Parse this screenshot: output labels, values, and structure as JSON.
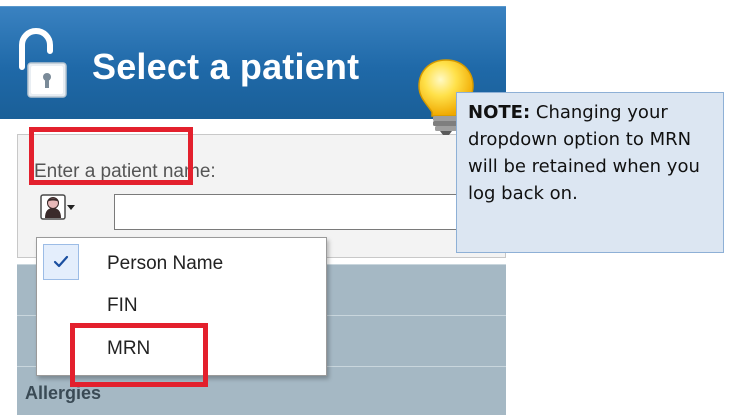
{
  "panel": {
    "title": "Select a patient",
    "search_label": "Enter a patient name:",
    "search_value": "",
    "header_color": "#2371b0"
  },
  "dropdown": {
    "selected": "Person Name",
    "options": [
      {
        "label": "Person Name",
        "checked": true
      },
      {
        "label": "FIN",
        "checked": false
      },
      {
        "label": "MRN",
        "checked": false
      }
    ]
  },
  "sections": [
    {
      "label": ""
    },
    {
      "label": ""
    },
    {
      "label": "Allergies"
    }
  ],
  "note": {
    "prefix": "NOTE:",
    "text": "Changing your dropdown option to MRN will be retained when you log back on."
  },
  "icons": {
    "lock": "lock-icon",
    "person": "person-icon",
    "dropdown_arrow": "chevron-down-icon",
    "check": "check-icon",
    "bulb": "lightbulb-icon"
  },
  "highlight_color": "#e3202d"
}
